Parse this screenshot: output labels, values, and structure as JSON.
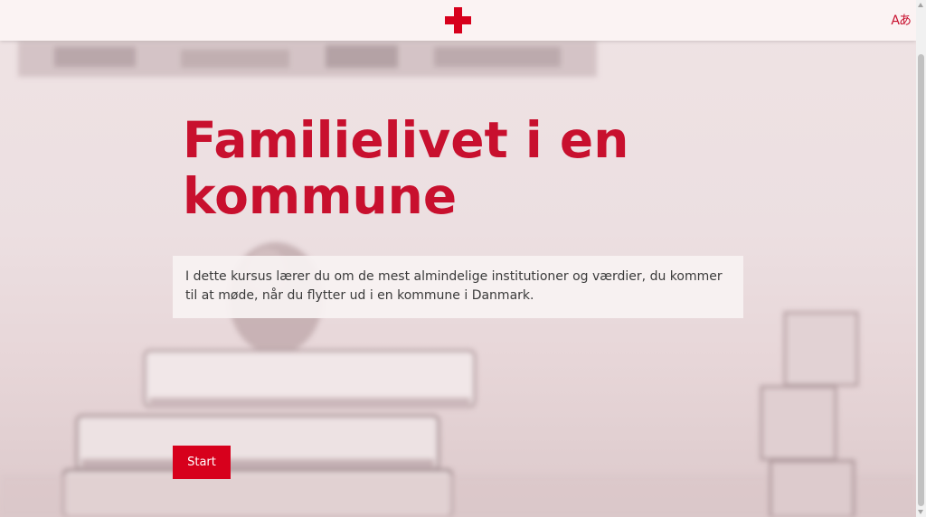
{
  "header": {
    "logo_icon": "red-cross-icon",
    "translate_icon": "translate-icon",
    "translate_label": "Aあ",
    "accent_color": "#d7001c"
  },
  "main": {
    "title": "Familielivet i en kommune",
    "description": "I dette kursus lærer du om de mest almindelige institutioner og værdier, du kommer til at møde, når du flytter ud i en kommune i Danmark.",
    "start_label": "Start",
    "title_color": "#c8102e"
  }
}
